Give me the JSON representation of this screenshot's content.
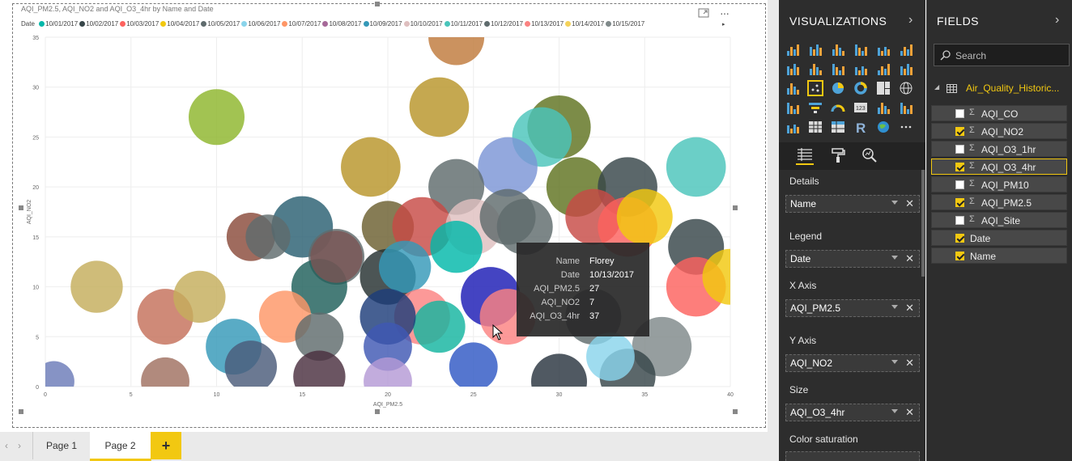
{
  "chart_data": {
    "type": "scatter",
    "title": "AQI_PM2.5, AQI_NO2 and AQI_O3_4hr by Name and Date",
    "xlabel": "AQI_PM2.5",
    "ylabel": "AQI_NO2",
    "xlim": [
      0,
      40
    ],
    "ylim": [
      0,
      35
    ],
    "xticks": [
      0,
      5,
      10,
      15,
      20,
      25,
      30,
      35,
      40
    ],
    "yticks": [
      0,
      5,
      10,
      15,
      20,
      25,
      30,
      35
    ],
    "grid": true,
    "legend_title": "Date",
    "legend_position": "top",
    "series": [
      {
        "name": "10/01/2017",
        "color": "#01b8aa"
      },
      {
        "name": "10/02/2017",
        "color": "#374649"
      },
      {
        "name": "10/03/2017",
        "color": "#fd625e"
      },
      {
        "name": "10/04/2017",
        "color": "#f2c80f"
      },
      {
        "name": "10/05/2017",
        "color": "#5f6b6d"
      },
      {
        "name": "10/06/2017",
        "color": "#8ad4eb"
      },
      {
        "name": "10/07/2017",
        "color": "#fe9666"
      },
      {
        "name": "10/08/2017",
        "color": "#a66999"
      },
      {
        "name": "10/09/2017",
        "color": "#3599b8"
      },
      {
        "name": "10/10/2017",
        "color": "#dfbfbf"
      },
      {
        "name": "10/11/2017",
        "color": "#4ac5bb"
      },
      {
        "name": "10/12/2017",
        "color": "#5f6b6d"
      },
      {
        "name": "10/13/2017",
        "color": "#fb8281"
      },
      {
        "name": "10/14/2017",
        "color": "#f4d25a"
      },
      {
        "name": "10/15/2017",
        "color": "#7f898a"
      }
    ],
    "points": [
      {
        "x": 24,
        "y": 35,
        "size": 3,
        "color": "#c07a3c"
      },
      {
        "x": 10,
        "y": 27,
        "size": 3,
        "color": "#8db62c"
      },
      {
        "x": 23,
        "y": 28,
        "size": 3.2,
        "color": "#b8952a"
      },
      {
        "x": 19,
        "y": 22,
        "size": 3.2,
        "color": "#b8952a"
      },
      {
        "x": 30,
        "y": 26,
        "size": 3.4,
        "color": "#5f7320"
      },
      {
        "x": 29,
        "y": 25,
        "size": 3.2,
        "color": "#4ac5bb"
      },
      {
        "x": 27,
        "y": 22,
        "size": 3.2,
        "color": "#7b95d6"
      },
      {
        "x": 38,
        "y": 22,
        "size": 3.2,
        "color": "#4ac5bb"
      },
      {
        "x": 31,
        "y": 20,
        "size": 3.2,
        "color": "#5f7320"
      },
      {
        "x": 34,
        "y": 20,
        "size": 3.2,
        "color": "#374649"
      },
      {
        "x": 24,
        "y": 20,
        "size": 3,
        "color": "#5f6b6d"
      },
      {
        "x": 12,
        "y": 15,
        "size": 2.6,
        "color": "#8a4a3a"
      },
      {
        "x": 15,
        "y": 16,
        "size": 3.3,
        "color": "#2a5f72"
      },
      {
        "x": 13,
        "y": 15,
        "size": 2.4,
        "color": "#5f6b6d"
      },
      {
        "x": 17,
        "y": 13,
        "size": 3,
        "color": "#5f6b6d"
      },
      {
        "x": 20,
        "y": 16,
        "size": 2.8,
        "color": "#6b5f2f"
      },
      {
        "x": 22,
        "y": 16,
        "size": 3.2,
        "color": "#c74a45"
      },
      {
        "x": 25,
        "y": 16,
        "size": 3,
        "color": "#dfbfbf"
      },
      {
        "x": 27,
        "y": 17,
        "size": 3,
        "color": "#5f6b6d"
      },
      {
        "x": 28,
        "y": 16,
        "size": 3,
        "color": "#5f6b6d"
      },
      {
        "x": 32,
        "y": 17,
        "size": 3,
        "color": "#c74a45"
      },
      {
        "x": 34,
        "y": 16,
        "size": 3.2,
        "color": "#fd625e"
      },
      {
        "x": 35,
        "y": 17,
        "size": 3,
        "color": "#f2c80f"
      },
      {
        "x": 38,
        "y": 14,
        "size": 3,
        "color": "#374649"
      },
      {
        "x": 38,
        "y": 10,
        "size": 3.2,
        "color": "#fd625e"
      },
      {
        "x": 40,
        "y": 11,
        "size": 3,
        "color": "#f2c80f"
      },
      {
        "x": 36,
        "y": 4,
        "size": 3.2,
        "color": "#7f898a"
      },
      {
        "x": 32,
        "y": 7,
        "size": 3,
        "color": "#5f6b6d"
      },
      {
        "x": 24,
        "y": 14,
        "size": 2.8,
        "color": "#01b8aa"
      },
      {
        "x": 26,
        "y": 9,
        "size": 3.2,
        "color": "#1b1bb5"
      },
      {
        "x": 20,
        "y": 11,
        "size": 3,
        "color": "#243030"
      },
      {
        "x": 16,
        "y": 10,
        "size": 3,
        "color": "#1f5f5a"
      },
      {
        "x": 17,
        "y": 13,
        "size": 2.8,
        "color": "#7a5555"
      },
      {
        "x": 21,
        "y": 12,
        "size": 2.8,
        "color": "#3599b8"
      },
      {
        "x": 22,
        "y": 7,
        "size": 3,
        "color": "#fb8281"
      },
      {
        "x": 23,
        "y": 6,
        "size": 2.8,
        "color": "#13b5a0"
      },
      {
        "x": 20,
        "y": 7,
        "size": 3,
        "color": "#1d3d7a"
      },
      {
        "x": 27,
        "y": 7,
        "size": 3,
        "color": "#fb8281"
      },
      {
        "x": 3,
        "y": 10,
        "size": 2.8,
        "color": "#c4ad5c"
      },
      {
        "x": 7,
        "y": 7,
        "size": 3,
        "color": "#c4705a"
      },
      {
        "x": 9,
        "y": 9,
        "size": 2.8,
        "color": "#c4ad5c"
      },
      {
        "x": 14,
        "y": 7,
        "size": 2.8,
        "color": "#fe9666"
      },
      {
        "x": 11,
        "y": 4,
        "size": 3,
        "color": "#3599b8"
      },
      {
        "x": 12,
        "y": 2,
        "size": 2.8,
        "color": "#4a5b7a"
      },
      {
        "x": 16,
        "y": 5,
        "size": 2.6,
        "color": "#5f6b6d"
      },
      {
        "x": 20,
        "y": 4,
        "size": 2.6,
        "color": "#3f58b3"
      },
      {
        "x": 16,
        "y": 1,
        "size": 2.8,
        "color": "#4a3040"
      },
      {
        "x": 20,
        "y": 0.5,
        "size": 2.6,
        "color": "#b59ad6"
      },
      {
        "x": 25,
        "y": 2,
        "size": 2.6,
        "color": "#3058c4"
      },
      {
        "x": 30,
        "y": 0.5,
        "size": 3,
        "color": "#2a3440"
      },
      {
        "x": 34,
        "y": 1,
        "size": 3,
        "color": "#374649"
      },
      {
        "x": 33,
        "y": 3,
        "size": 2.6,
        "color": "#8ad4eb"
      },
      {
        "x": 0.5,
        "y": 0.5,
        "size": 2.2,
        "color": "#6b7bb8"
      },
      {
        "x": 7,
        "y": 0.5,
        "size": 2.6,
        "color": "#a07060"
      }
    ]
  },
  "tooltip": {
    "rows": [
      {
        "label": "Name",
        "value": "Florey"
      },
      {
        "label": "Date",
        "value": "10/13/2017"
      },
      {
        "label": "AQI_PM2.5",
        "value": "27"
      },
      {
        "label": "AQI_NO2",
        "value": "7"
      },
      {
        "label": "AQI_O3_4hr",
        "value": "37"
      }
    ]
  },
  "page_tabs": {
    "tabs": [
      "Page 1",
      "Page 2"
    ],
    "active": "Page 2",
    "add_label": "+"
  },
  "viz_pane": {
    "title": "VISUALIZATIONS",
    "wells": {
      "details_label": "Details",
      "details_value": "Name",
      "legend_label": "Legend",
      "legend_value": "Date",
      "xaxis_label": "X Axis",
      "xaxis_value": "AQI_PM2.5",
      "yaxis_label": "Y Axis",
      "yaxis_value": "AQI_NO2",
      "size_label": "Size",
      "size_value": "AQI_O3_4hr",
      "color_label": "Color saturation"
    }
  },
  "fields_pane": {
    "title": "FIELDS",
    "search_placeholder": "Search",
    "table_name": "Air_Quality_Historic...",
    "fields": [
      {
        "name": "AQI_CO",
        "checked": false,
        "sigma": true
      },
      {
        "name": "AQI_NO2",
        "checked": true,
        "sigma": true
      },
      {
        "name": "AQI_O3_1hr",
        "checked": false,
        "sigma": true
      },
      {
        "name": "AQI_O3_4hr",
        "checked": true,
        "sigma": true
      },
      {
        "name": "AQI_PM10",
        "checked": false,
        "sigma": true
      },
      {
        "name": "AQI_PM2.5",
        "checked": true,
        "sigma": true
      },
      {
        "name": "AQI_Site",
        "checked": false,
        "sigma": true
      },
      {
        "name": "Date",
        "checked": true,
        "sigma": false
      },
      {
        "name": "Name",
        "checked": true,
        "sigma": false
      }
    ],
    "accent": "#f2c811"
  }
}
